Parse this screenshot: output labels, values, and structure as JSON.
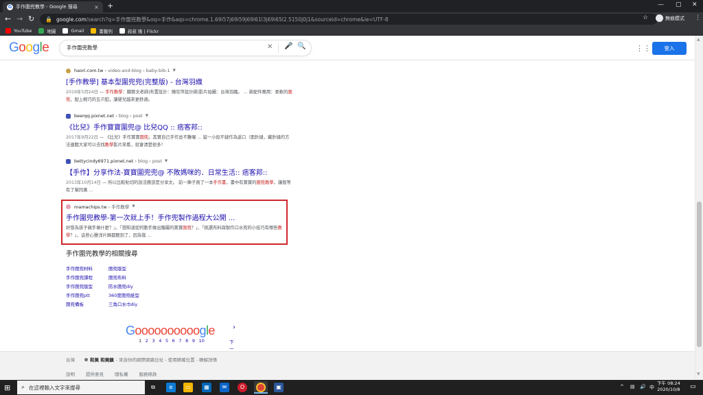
{
  "browser": {
    "tab_title": "手作圍兜教學 - Google 搜尋",
    "tab_close": "×",
    "new_tab": "+",
    "url_domain": "google.com",
    "url_rest": "/search?q=手作圍兜教學&oq=手作&aqs=chrome.1.69i57j69i59j69i61l3j69i65l2.5150j0j1&sourceid=chrome&ie=UTF-8",
    "profile_name": "無痕模式",
    "window_controls": [
      "—",
      "▢",
      "✕"
    ],
    "bookmarks": [
      {
        "label": "YouTube",
        "color": "#ff0000"
      },
      {
        "label": "地圖",
        "color": "#34a853"
      },
      {
        "label": "Gmail",
        "color": "#ffffff"
      },
      {
        "label": "書籤列",
        "color": "#fbbc04"
      },
      {
        "label": "叔叔 隆 | Flickr",
        "color": "#ffffff"
      }
    ]
  },
  "google": {
    "logo_letters": [
      {
        "ch": "G",
        "color": "#4285f4"
      },
      {
        "ch": "o",
        "color": "#ea4335"
      },
      {
        "ch": "o",
        "color": "#fbbc05"
      },
      {
        "ch": "g",
        "color": "#4285f4"
      },
      {
        "ch": "l",
        "color": "#34a853"
      },
      {
        "ch": "e",
        "color": "#ea4335"
      }
    ],
    "query": "手作圍兜教學",
    "signin_label": "登入"
  },
  "results": [
    {
      "site": "haori.com.tw",
      "path": " › video-and-blog › baby-bib-1",
      "icon_color": "#c8a24a",
      "title": "[手作教學] 基本型圍兜兜(完整版) - 台灣羽織",
      "date": "2019年5月24日",
      "snippet_parts": [
        {
          "t": " — ",
          "hl": false
        },
        {
          "t": "手作教學",
          "hl": true
        },
        {
          "t": "：職藝文老師|布置設計：陳欣萍設計師|影片拍攝：台灣羽織。 ... 新配件應用：柔軟的",
          "hl": false
        },
        {
          "t": "圍兜",
          "hl": true
        },
        {
          "t": "，配上輕巧的五爪釦，讓嬰兒越來更舒適。",
          "hl": false
        }
      ]
    },
    {
      "site": "beerqq.pixnet.net",
      "path": " › blog › post",
      "icon_color": "#3f51b5",
      "title": "《比兒》手作寶寶圍兜@ 比兒QQ :: 痞客邦::",
      "date": "2017年9月22日",
      "snippet_parts": [
        {
          "t": " — 《比兒》手作寶寶",
          "hl": false
        },
        {
          "t": "圍兜",
          "hl": true
        },
        {
          "t": "。其實自己手作並不難喔 ... 留一小段不縫作為返口（面針縫，藏針縫的方法連聽大家可以去找",
          "hl": false
        },
        {
          "t": "教學",
          "hl": true
        },
        {
          "t": "影片來看，就會清楚很多！",
          "hl": false
        }
      ]
    },
    {
      "site": "bettycindy6971.pixnet.net",
      "path": " › blog › post",
      "icon_color": "#3f51b5",
      "title": "【手作】分享作法-寶寶圍兜兜@ 不敗媽咪的．日常生活:: 痞客邦::",
      "date": "2013年10月14日",
      "snippet_parts": [
        {
          "t": " — 所以比較貼切的說法應該是分享文。 前一陣子買了一本",
          "hl": false
        },
        {
          "t": "手作書",
          "hl": true
        },
        {
          "t": "，書中有寶寶的",
          "hl": false
        },
        {
          "t": "圍兜教學",
          "hl": true
        },
        {
          "t": "，讓我等有了幫同黃 ...",
          "hl": false
        }
      ]
    },
    {
      "site": "mamachips.tw",
      "path": " › 手作教學",
      "icon_color": "#e8a0b4",
      "title": "手作圍兜教學-第一次就上手！手作兜製作過程大公開 ...",
      "date": "",
      "snippet_parts": [
        {
          "t": "好想為孩子親手做什麼？」、「想知道如何動手做出獨屬的寶寶",
          "hl": false
        },
        {
          "t": "圍兜",
          "hl": true
        },
        {
          "t": "？」、「挑選布料與製作口水兜的小技巧有哪些",
          "hl": false
        },
        {
          "t": "教學",
          "hl": true
        },
        {
          "t": "？」，這些心聲洋片媽都聽到了，因為我 ...",
          "hl": false
        }
      ]
    }
  ],
  "related": {
    "title": "手作圍兜教學的相關搜尋",
    "left": [
      "手作圍兜材料",
      "手作圍兜課程",
      "手作圍兜版型",
      "手作圍兜ptt",
      "圍兜備板"
    ],
    "right": [
      "圍兜版型",
      "圍兜布料",
      "防水圍兜diy",
      "360度圍兜紙型",
      "三角口水巾diy"
    ]
  },
  "pager": {
    "logo_letters": [
      {
        "ch": "G",
        "color": "#4285f4"
      },
      {
        "ch": "oooooooooo",
        "color": "#ea4335"
      },
      {
        "ch": "g",
        "color": "#4285f4"
      },
      {
        "ch": "l",
        "color": "#34a853"
      },
      {
        "ch": "e",
        "color": "#ea4335"
      }
    ],
    "pages": [
      "1",
      "2",
      "3",
      "4",
      "5",
      "6",
      "7",
      "8",
      "9",
      "10"
    ],
    "current_page": "1",
    "next_arrow": "›",
    "next_label": "下一頁"
  },
  "footer": {
    "country": "台灣",
    "location_bold": "和美 和美鎮",
    "location_rest": " - 來自你的網際網路位址 - 使用精確位置 - 瞭解詳情",
    "links": [
      "說明",
      "提供意見",
      "隱私權",
      "服務條款"
    ]
  },
  "taskbar": {
    "search_placeholder": "在這裡輸入文字來搜尋",
    "clock_time": "下午 08:24",
    "clock_date": "2020/10/8",
    "lang": "中"
  }
}
